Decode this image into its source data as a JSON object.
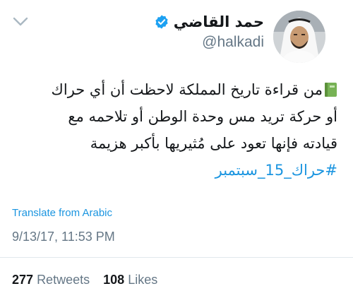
{
  "header": {
    "display_name": "حمد القاضي",
    "handle": "@halkadi",
    "verified": true,
    "more_icon": "chevron-down-icon",
    "avatar_icon": "avatar-photo"
  },
  "tweet": {
    "emoji_icon": "green-book-icon",
    "lines": [
      "من قراءة تاريخ المملكة لاحظت أن أي حراك",
      "أو حركة تريد مس وحدة الوطن أو تلاحمه مع",
      "قيادته فإنها تعود على مُثيريها بأكبر هزيمة"
    ],
    "hashtag": "#حراك_15_سبتمبر",
    "translate_label": "Translate from Arabic",
    "timestamp": "9/13/17, 11:53 PM"
  },
  "stats": {
    "retweets_count": "277",
    "retweets_label": "Retweets",
    "likes_count": "108",
    "likes_label": "Likes"
  },
  "colors": {
    "link": "#1b95e0",
    "muted": "#657786",
    "text": "#14171a",
    "divider": "#e1e8ed",
    "verified": "#1da1f2",
    "book": "#77b255"
  }
}
